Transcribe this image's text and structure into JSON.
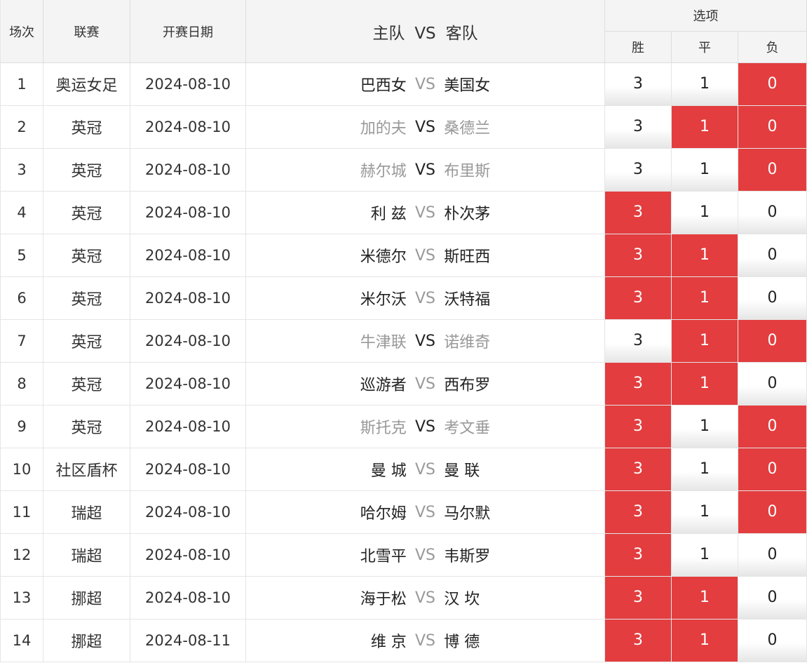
{
  "header": {
    "col_no": "场次",
    "col_league": "联赛",
    "col_date": "开赛日期",
    "col_home": "主队",
    "col_vs": "VS",
    "col_away": "客队",
    "col_options": "选项",
    "opt_win": "胜",
    "opt_draw": "平",
    "opt_lose": "负"
  },
  "colors": {
    "selected": "#e33d3f",
    "header_bg": "#f4f4f4",
    "grey_text": "#999999"
  },
  "rows": [
    {
      "no": "1",
      "league": "奥运女足",
      "date": "2024-08-10",
      "home": "巴西女",
      "away": "美国女",
      "teams_dim": false,
      "vs_dim": true,
      "win": "3",
      "draw": "1",
      "lose": "0",
      "sel": [
        false,
        false,
        true
      ]
    },
    {
      "no": "2",
      "league": "英冠",
      "date": "2024-08-10",
      "home": "加的夫",
      "away": "桑德兰",
      "teams_dim": true,
      "vs_dim": false,
      "win": "3",
      "draw": "1",
      "lose": "0",
      "sel": [
        false,
        true,
        true
      ]
    },
    {
      "no": "3",
      "league": "英冠",
      "date": "2024-08-10",
      "home": "赫尔城",
      "away": "布里斯",
      "teams_dim": true,
      "vs_dim": false,
      "win": "3",
      "draw": "1",
      "lose": "0",
      "sel": [
        false,
        false,
        true
      ]
    },
    {
      "no": "4",
      "league": "英冠",
      "date": "2024-08-10",
      "home": "利 兹",
      "away": "朴次茅",
      "teams_dim": false,
      "vs_dim": true,
      "win": "3",
      "draw": "1",
      "lose": "0",
      "sel": [
        true,
        false,
        false
      ]
    },
    {
      "no": "5",
      "league": "英冠",
      "date": "2024-08-10",
      "home": "米德尔",
      "away": "斯旺西",
      "teams_dim": false,
      "vs_dim": true,
      "win": "3",
      "draw": "1",
      "lose": "0",
      "sel": [
        true,
        true,
        false
      ]
    },
    {
      "no": "6",
      "league": "英冠",
      "date": "2024-08-10",
      "home": "米尔沃",
      "away": "沃特福",
      "teams_dim": false,
      "vs_dim": true,
      "win": "3",
      "draw": "1",
      "lose": "0",
      "sel": [
        true,
        true,
        false
      ]
    },
    {
      "no": "7",
      "league": "英冠",
      "date": "2024-08-10",
      "home": "牛津联",
      "away": "诺维奇",
      "teams_dim": true,
      "vs_dim": false,
      "win": "3",
      "draw": "1",
      "lose": "0",
      "sel": [
        false,
        true,
        true
      ]
    },
    {
      "no": "8",
      "league": "英冠",
      "date": "2024-08-10",
      "home": "巡游者",
      "away": "西布罗",
      "teams_dim": false,
      "vs_dim": true,
      "win": "3",
      "draw": "1",
      "lose": "0",
      "sel": [
        true,
        true,
        false
      ]
    },
    {
      "no": "9",
      "league": "英冠",
      "date": "2024-08-10",
      "home": "斯托克",
      "away": "考文垂",
      "teams_dim": true,
      "vs_dim": false,
      "win": "3",
      "draw": "1",
      "lose": "0",
      "sel": [
        true,
        false,
        true
      ]
    },
    {
      "no": "10",
      "league": "社区盾杯",
      "date": "2024-08-10",
      "home": "曼 城",
      "away": "曼 联",
      "teams_dim": false,
      "vs_dim": true,
      "win": "3",
      "draw": "1",
      "lose": "0",
      "sel": [
        true,
        false,
        true
      ]
    },
    {
      "no": "11",
      "league": "瑞超",
      "date": "2024-08-10",
      "home": "哈尔姆",
      "away": "马尔默",
      "teams_dim": false,
      "vs_dim": true,
      "win": "3",
      "draw": "1",
      "lose": "0",
      "sel": [
        true,
        false,
        true
      ]
    },
    {
      "no": "12",
      "league": "瑞超",
      "date": "2024-08-10",
      "home": "北雪平",
      "away": "韦斯罗",
      "teams_dim": false,
      "vs_dim": true,
      "win": "3",
      "draw": "1",
      "lose": "0",
      "sel": [
        true,
        false,
        false
      ]
    },
    {
      "no": "13",
      "league": "挪超",
      "date": "2024-08-10",
      "home": "海于松",
      "away": "汉 坎",
      "teams_dim": false,
      "vs_dim": true,
      "win": "3",
      "draw": "1",
      "lose": "0",
      "sel": [
        true,
        true,
        false
      ]
    },
    {
      "no": "14",
      "league": "挪超",
      "date": "2024-08-11",
      "home": "维 京",
      "away": "博 德",
      "teams_dim": false,
      "vs_dim": true,
      "win": "3",
      "draw": "1",
      "lose": "0",
      "sel": [
        true,
        true,
        false
      ]
    }
  ]
}
